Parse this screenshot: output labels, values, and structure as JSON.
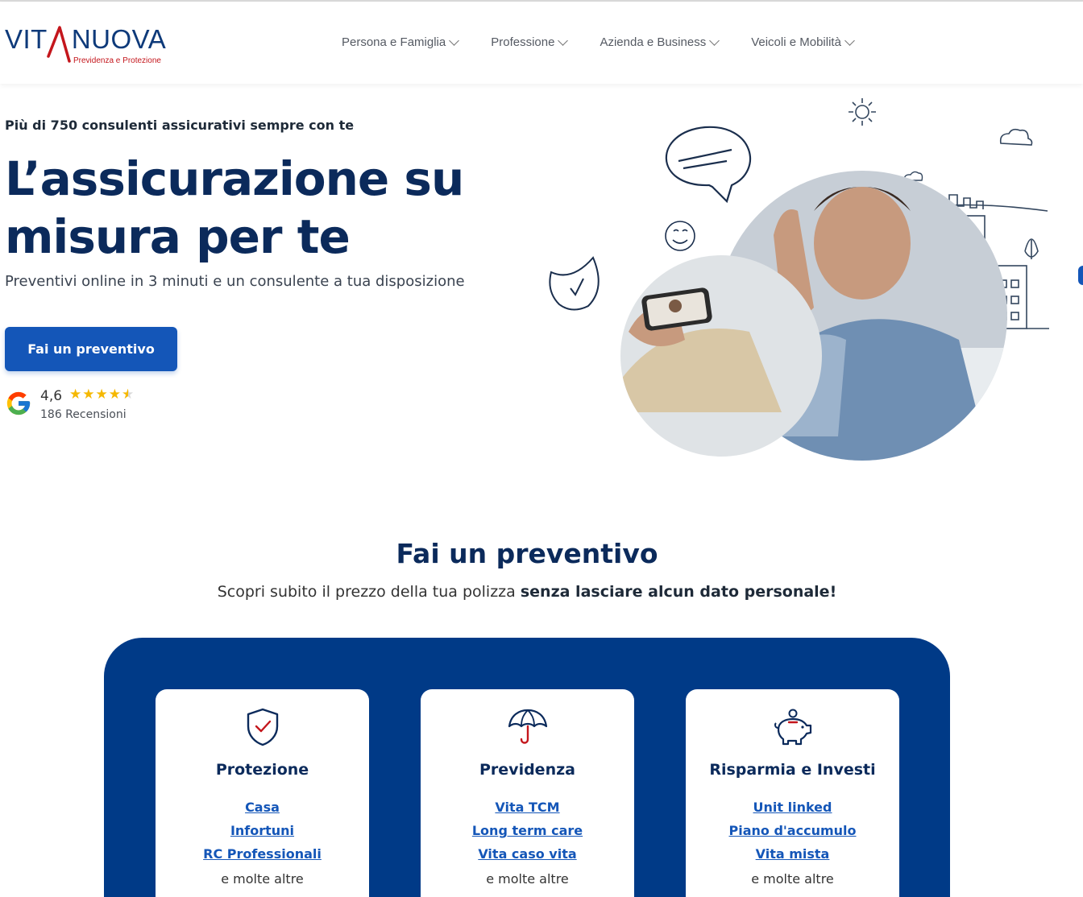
{
  "header": {
    "logo_text_left": "VIT",
    "logo_text_right": "NUOVA",
    "logo_tagline": "Previdenza e Protezione",
    "nav": [
      {
        "label": "Persona e Famiglia"
      },
      {
        "label": "Professione"
      },
      {
        "label": "Azienda e Business"
      },
      {
        "label": "Veicoli e Mobilità"
      }
    ]
  },
  "hero": {
    "eyebrow": "Più di 750 consulenti assicurativi sempre con te",
    "title": "L’assicurazione su misura per te",
    "subtitle": "Preventivi online in 3 minuti e un consulente a tua disposizione",
    "cta_label": "Fai un preventivo",
    "rating": {
      "value": "4,6",
      "stars": 4.5,
      "count_label": "186 Recensioni",
      "icon": "google-g-icon"
    }
  },
  "section": {
    "title": "Fai un preventivo",
    "subtitle_plain": "Scopri subito il prezzo della tua polizza ",
    "subtitle_bold": "senza lasciare alcun dato personale!"
  },
  "cards": [
    {
      "icon": "shield-check-icon",
      "title": "Protezione",
      "links": [
        "Casa",
        "Infortuni",
        "RC Professionali"
      ],
      "more": "e molte altre"
    },
    {
      "icon": "umbrella-icon",
      "title": "Previdenza",
      "links": [
        "Vita TCM",
        "Long term care",
        "Vita caso vita"
      ],
      "more": "e molte altre"
    },
    {
      "icon": "piggy-bank-icon",
      "title": "Risparmia e Investi",
      "links": [
        "Unit linked",
        "Piano d'accumulo",
        "Vita mista"
      ],
      "more": "e molte altre"
    }
  ],
  "colors": {
    "brand_blue": "#0b2a5b",
    "cta_blue": "#1456b8",
    "panel_blue": "#003a87",
    "accent_red": "#c4161c"
  }
}
